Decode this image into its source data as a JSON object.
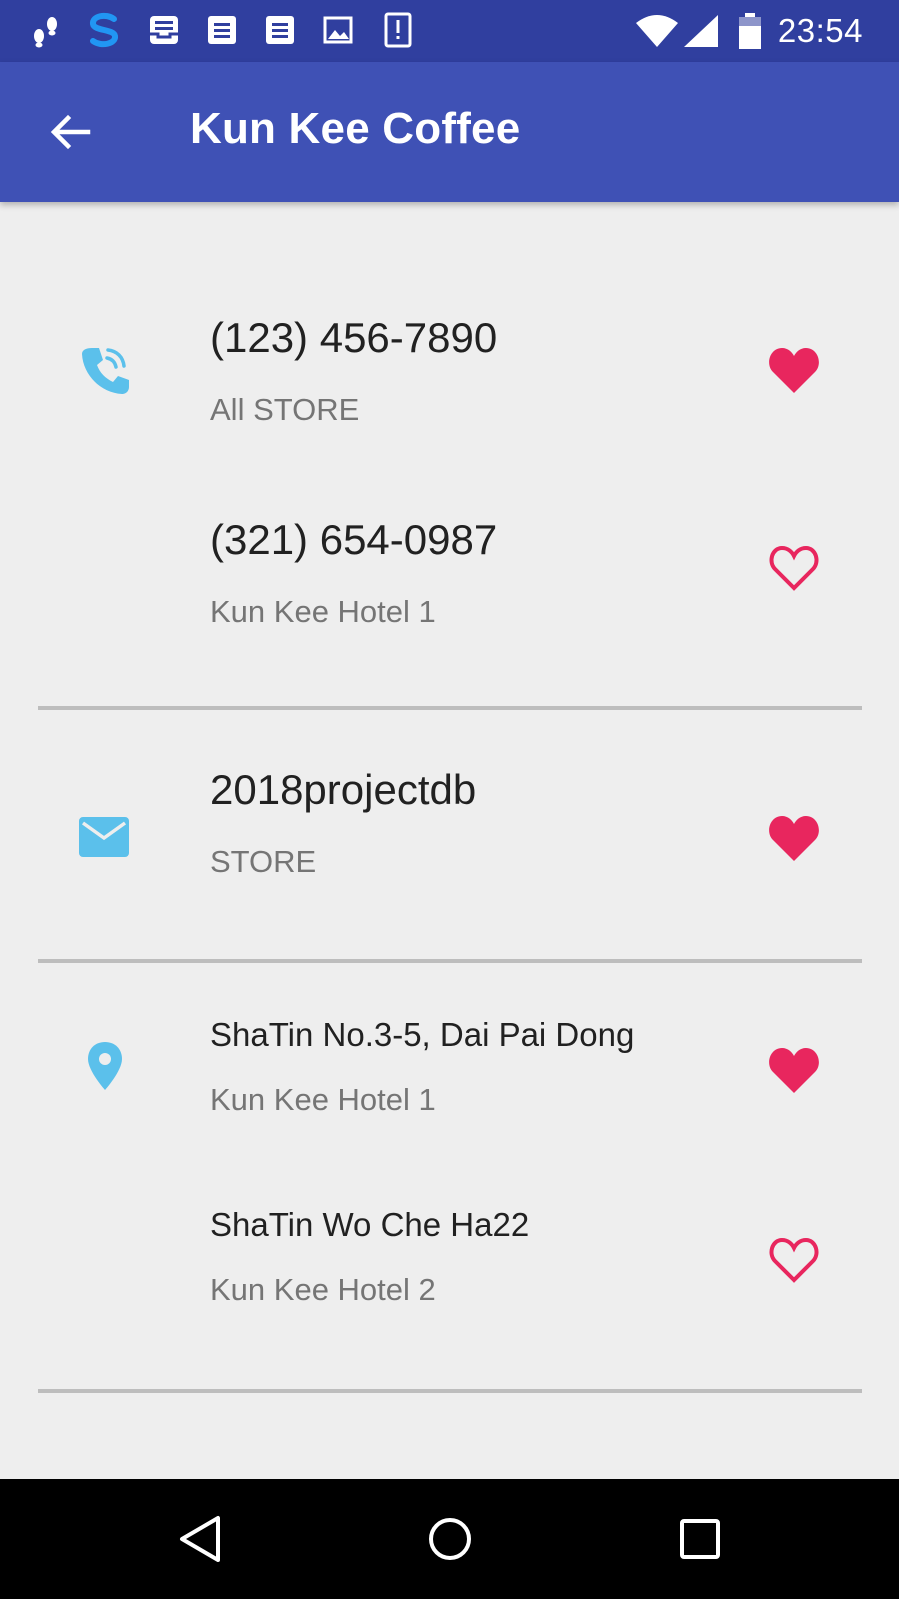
{
  "status_bar": {
    "notification_icons": [
      "footsteps-icon",
      "s-app-icon",
      "inbox-icon",
      "document-icon",
      "document-icon",
      "image-icon",
      "alert-icon"
    ],
    "right_icons": [
      "wifi-icon",
      "signal-icon",
      "battery-icon"
    ],
    "time": "23:54"
  },
  "app_bar": {
    "back_icon": "arrow-back-icon",
    "title": "Kun Kee Coffee",
    "color": "#3f51b5",
    "status_color": "#303f9f"
  },
  "sections": {
    "phones": {
      "icon": "phone-icon",
      "items": [
        {
          "value": "(123) 456-7890",
          "label": "All STORE",
          "favorite": true
        },
        {
          "value": "(321) 654-0987",
          "label": "Kun Kee Hotel 1",
          "favorite": false
        }
      ]
    },
    "emails": {
      "icon": "email-icon",
      "items": [
        {
          "value": "2018projectdb",
          "label": "STORE",
          "favorite": true
        }
      ]
    },
    "addresses": {
      "icon": "location-pin-icon",
      "items": [
        {
          "value": "ShaTin No.3-5, Dai Pai Dong",
          "label": "Kun Kee Hotel 1",
          "favorite": true
        },
        {
          "value": "ShaTin Wo Che Ha22",
          "label": "Kun Kee Hotel 2",
          "favorite": false
        }
      ]
    }
  },
  "colors": {
    "accent_icon": "#5bc0eb",
    "favorite": "#e8265e",
    "primary_text": "#212121",
    "secondary_text": "#757575"
  },
  "nav_bar": {
    "buttons": [
      "back-triangle-icon",
      "home-circle-icon",
      "recents-square-icon"
    ]
  }
}
